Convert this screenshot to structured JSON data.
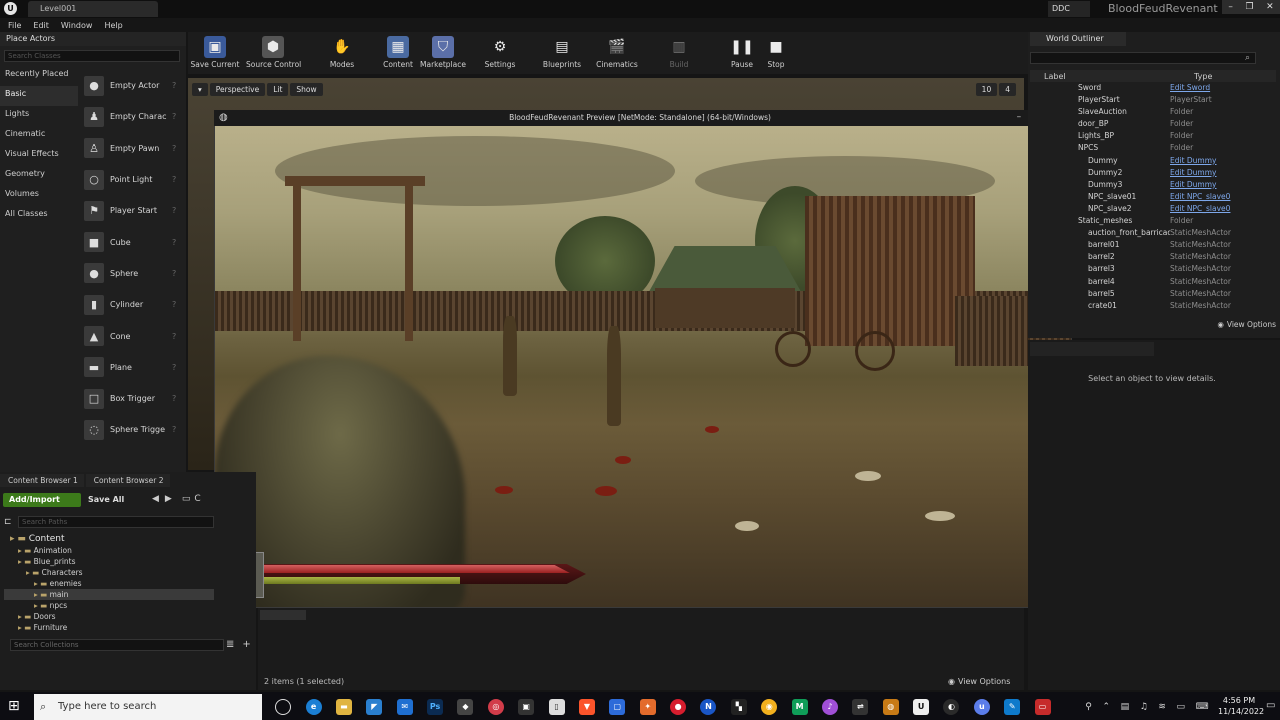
{
  "titlebar": {
    "level_tab": "Level001",
    "ddc_label": "DDC",
    "project_name": "BloodFeudRevenant",
    "minimize": "–",
    "restore": "❐",
    "close": "✕"
  },
  "menu": [
    "File",
    "Edit",
    "Window",
    "Help"
  ],
  "place_actors": {
    "title": "Place Actors",
    "search_placeholder": "Search Classes",
    "categories": [
      "Recently Placed",
      "Basic",
      "Lights",
      "Cinematic",
      "Visual Effects",
      "Geometry",
      "Volumes",
      "All Classes"
    ],
    "selected_category": "Basic",
    "items": [
      "Empty Actor",
      "Empty Charac",
      "Empty Pawn",
      "Point Light",
      "Player Start",
      "Cube",
      "Sphere",
      "Cylinder",
      "Cone",
      "Plane",
      "Box Trigger",
      "Sphere Trigge"
    ]
  },
  "toolbar": {
    "buttons": [
      "Save Current",
      "Source Control",
      "Modes",
      "Content",
      "Marketplace",
      "Settings",
      "Blueprints",
      "Cinematics",
      "Build",
      "Pause",
      "Stop"
    ]
  },
  "viewport": {
    "perspective": "Perspective",
    "lit": "Lit",
    "show": "Show",
    "grid_snap": "10",
    "camera_speed": "4"
  },
  "game_window": {
    "title": "BloodFeudRevenant Preview [NetMode: Standalone]  (64-bit/Windows)",
    "health_pct": 95,
    "stamina_pct": 61
  },
  "outliner": {
    "title": "World Outliner",
    "col_label": "Label",
    "col_type": "Type",
    "rows": [
      {
        "label": "Sword",
        "type": "Edit Sword",
        "link": true
      },
      {
        "label": "PlayerStart",
        "type": "PlayerStart",
        "link": false
      },
      {
        "label": "SlaveAuction",
        "type": "Folder",
        "link": false
      },
      {
        "label": "door_BP",
        "type": "Folder",
        "link": false
      },
      {
        "label": "Lights_BP",
        "type": "Folder",
        "link": false
      },
      {
        "label": "NPCS",
        "type": "Folder",
        "link": false
      },
      {
        "label": "Dummy",
        "type": "Edit Dummy",
        "link": true
      },
      {
        "label": "Dummy2",
        "type": "Edit Dummy",
        "link": true
      },
      {
        "label": "Dummy3",
        "type": "Edit Dummy",
        "link": true
      },
      {
        "label": "NPC_slave01",
        "type": "Edit NPC_slave0",
        "link": true
      },
      {
        "label": "NPC_slave2",
        "type": "Edit NPC_slave0",
        "link": true
      },
      {
        "label": "Static_meshes",
        "type": "Folder",
        "link": false
      },
      {
        "label": "auction_front_barricade",
        "type": "StaticMeshActor",
        "link": false
      },
      {
        "label": "barrel01",
        "type": "StaticMeshActor",
        "link": false
      },
      {
        "label": "barrel2",
        "type": "StaticMeshActor",
        "link": false
      },
      {
        "label": "barrel3",
        "type": "StaticMeshActor",
        "link": false
      },
      {
        "label": "barrel4",
        "type": "StaticMeshActor",
        "link": false
      },
      {
        "label": "barrel5",
        "type": "StaticMeshActor",
        "link": false
      },
      {
        "label": "crate01",
        "type": "StaticMeshActor",
        "link": false
      }
    ],
    "view_options": "View Options"
  },
  "details": {
    "message": "Select an object to view details."
  },
  "content_browser": {
    "tabs": [
      "Content Browser 1",
      "Content Browser 2"
    ],
    "add_import": "Add/Import",
    "save_all": "Save All",
    "cut_label": "C",
    "search_paths_placeholder": "Search Paths",
    "tree": [
      {
        "label": "Content",
        "level": 0
      },
      {
        "label": "Animation",
        "level": 1
      },
      {
        "label": "Blue_prints",
        "level": 1
      },
      {
        "label": "Characters",
        "level": 2
      },
      {
        "label": "enemies",
        "level": 3
      },
      {
        "label": "main",
        "level": 3,
        "selected": true
      },
      {
        "label": "npcs",
        "level": 3
      },
      {
        "label": "Doors",
        "level": 1
      },
      {
        "label": "Furniture",
        "level": 1
      }
    ],
    "search_collections_placeholder": "Search Collections",
    "status": "2 items (1 selected)",
    "view_options": "View Options"
  },
  "taskbar": {
    "search_placeholder": "Type here to search",
    "time": "4:56 PM",
    "date": "11/14/2022"
  },
  "colors": {
    "add_import_green": "#3c7a1a",
    "link_blue": "#7da7ea",
    "health_red": "#c84848",
    "stamina_yellow": "#a9b545"
  }
}
